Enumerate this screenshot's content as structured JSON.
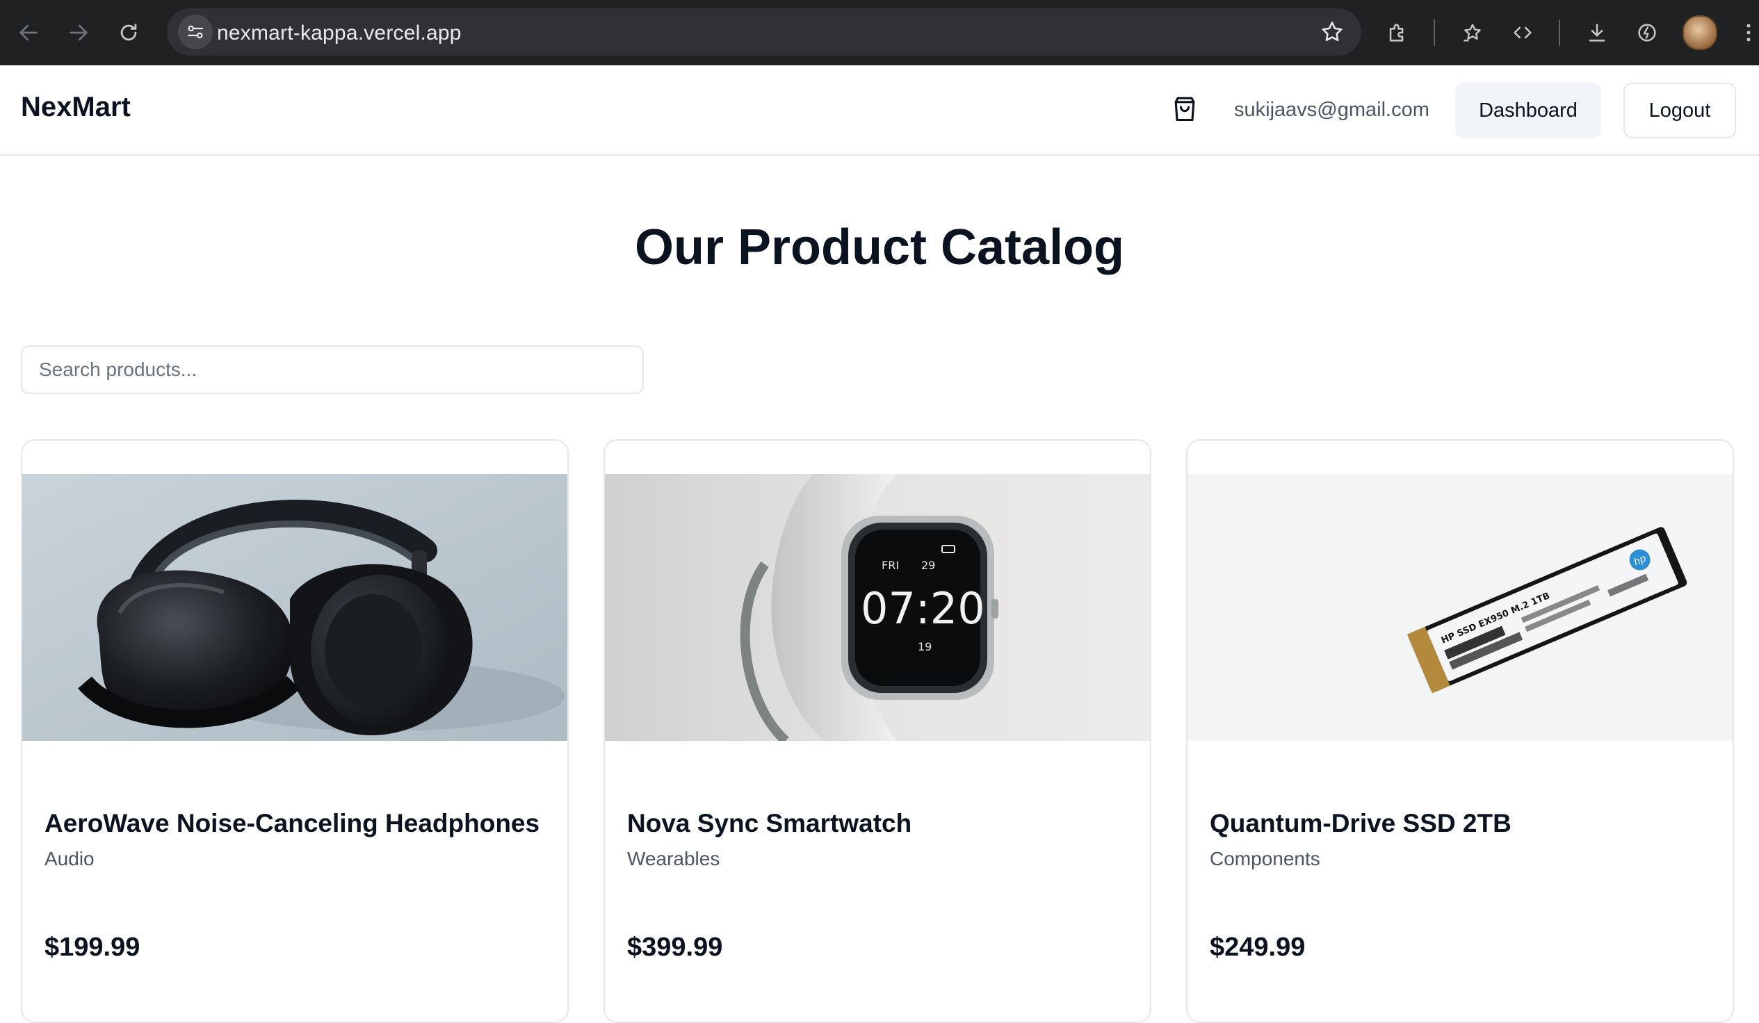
{
  "browser": {
    "url": "nexmart-kappa.vercel.app"
  },
  "header": {
    "logo": "NexMart",
    "user_email": "sukijaavs@gmail.com",
    "dashboard_label": "Dashboard",
    "logout_label": "Logout"
  },
  "main": {
    "title": "Our Product Catalog",
    "search_placeholder": "Search products..."
  },
  "products": [
    {
      "name": "AeroWave Noise-Canceling Headphones",
      "category": "Audio",
      "price": "$199.99",
      "image": "headphones"
    },
    {
      "name": "Nova Sync Smartwatch",
      "category": "Wearables",
      "price": "$399.99",
      "image": "smartwatch"
    },
    {
      "name": "Quantum-Drive SSD 2TB",
      "category": "Components",
      "price": "$249.99",
      "image": "ssd"
    }
  ],
  "smartwatch_screen": {
    "day": "FRI",
    "date": "29",
    "time": "07:20",
    "steps": "19"
  },
  "ssd_label": {
    "brand": "hp",
    "model": "HP SSD EX950 M.2 1TB"
  },
  "colors": {
    "text_primary": "#0b1220",
    "text_muted": "#4b5563",
    "border": "#e5e7eb",
    "dashboard_button_bg": "#f1f5f9",
    "chrome_bg": "#1f2123"
  }
}
